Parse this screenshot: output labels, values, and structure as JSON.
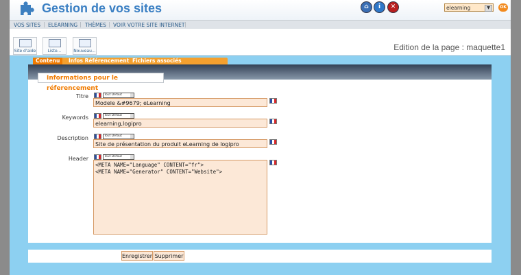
{
  "app": {
    "title": "Gestion de vos sites",
    "logo_icon": "puzzle-icon"
  },
  "header_controls": [
    {
      "name": "home-icon",
      "symbol": "⌂",
      "color": "#3b6fb5"
    },
    {
      "name": "info-icon",
      "symbol": "i",
      "color": "#2f78c9"
    },
    {
      "name": "close-icon",
      "symbol": "✕",
      "color": "#b91e1e"
    }
  ],
  "site_selector": {
    "selected": "elearning",
    "ok_label": "OK"
  },
  "nav": [
    "VOS SITES",
    "ELEARNING",
    "THÈMES",
    "VOIR VOTRE SITE INTERNET"
  ],
  "toolbar": {
    "buttons": [
      {
        "label": "Site d'aide",
        "icon": "help-site-icon"
      },
      {
        "label": "Liste...",
        "icon": "list-icon"
      },
      {
        "label": "Nouveau...",
        "icon": "new-page-icon"
      }
    ],
    "page_edit_label": "Edition de la page :  maquette1"
  },
  "tabs": [
    "Contenu",
    "Infos Référencement",
    "Fichiers associés"
  ],
  "section_title": "Informations pour le réferencement",
  "language_select": "Tout Défaut",
  "form": {
    "titre": {
      "label": "Titre",
      "value": "Modele &#9679; eLearning"
    },
    "keywords": {
      "label": "Keywords",
      "value": "elearning,logipro"
    },
    "description": {
      "label": "Description",
      "value": "Site de présentation du produit eLearning de logipro"
    },
    "header": {
      "label": "Header",
      "value": "<META NAME=\"Language\" CONTENT=\"fr\">\n<META NAME=\"Generator\" CONTENT=\"Website\">"
    }
  },
  "buttons": {
    "save": "Enregistrer",
    "delete": "Supprimer"
  },
  "colors": {
    "accent": "#f07b00",
    "title_blue": "#3a7fc3",
    "field_bg": "#fce8d7",
    "content_bg": "#8dd0f1"
  }
}
